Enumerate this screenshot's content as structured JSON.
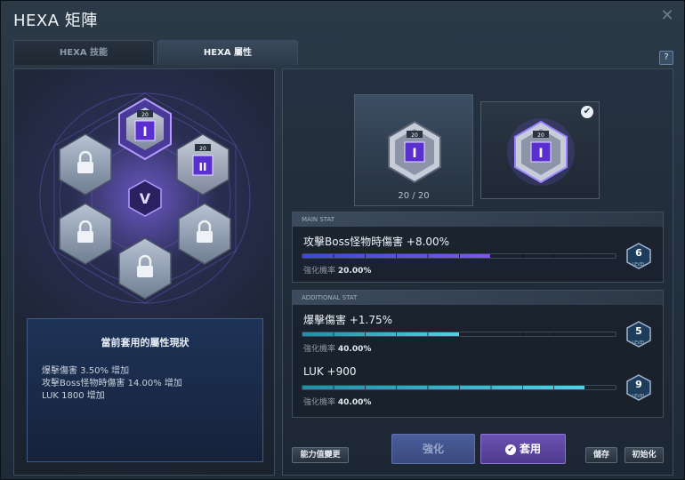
{
  "window": {
    "title": "HEXA 矩陣",
    "help_label": "?"
  },
  "tabs": [
    {
      "label": "HEXA 技能",
      "active": false
    },
    {
      "label": "HEXA 屬性",
      "active": true
    }
  ],
  "matrix": {
    "nodes": [
      {
        "id": "top",
        "level": "20",
        "glyph": "I",
        "state": "active-selected"
      },
      {
        "id": "upper-right",
        "level": "20",
        "glyph": "II",
        "state": "active"
      },
      {
        "id": "upper-left",
        "state": "locked"
      },
      {
        "id": "lower-left",
        "state": "locked"
      },
      {
        "id": "lower-right",
        "state": "locked"
      },
      {
        "id": "bottom",
        "state": "locked"
      }
    ],
    "center_glyph": "V"
  },
  "current_status": {
    "title": "當前套用的屬性現狀",
    "lines": [
      "爆擊傷害 3.50% 增加",
      "攻擊Boss怪物時傷害 14.00% 增加",
      "LUK 1800 增加"
    ]
  },
  "core_slots": {
    "slot_a": {
      "level": "20",
      "glyph": "I",
      "count": "20 / 20"
    },
    "slot_b": {
      "level": "20",
      "glyph": "I",
      "check": "✔"
    }
  },
  "main_stat": {
    "header": "MAIN STAT",
    "name": "攻擊Boss怪物時傷害 +8.00%",
    "progress_fraction": 0.6,
    "rate_label": "強化機率",
    "rate_value": "20.00%",
    "level": "6",
    "level_word": "LEVEL"
  },
  "additional_stat": {
    "header": "ADDITIONAL STAT",
    "items": [
      {
        "name": "爆擊傷害 +1.75%",
        "progress_fraction": 0.5,
        "rate_label": "強化機率",
        "rate_value": "40.00%",
        "level": "5",
        "level_word": "LEVEL"
      },
      {
        "name": "LUK +900",
        "progress_fraction": 0.9,
        "rate_label": "強化機率",
        "rate_value": "40.00%",
        "level": "9",
        "level_word": "LEVEL"
      }
    ]
  },
  "buttons": {
    "change": "能力值變更",
    "enhance": "強化",
    "apply": "套用",
    "save": "儲存",
    "reset": "初始化"
  },
  "colors": {
    "accent_purple": "#7d58e8",
    "accent_cyan": "#4fd2e6",
    "locked_gray": "#8d9aae",
    "panel_bg": "#1d2733"
  }
}
